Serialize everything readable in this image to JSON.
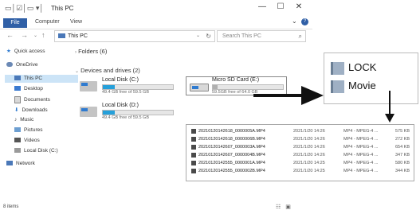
{
  "window": {
    "title": "This PC",
    "controls": {
      "minimize": "—",
      "maximize": "☐",
      "close": "✕"
    }
  },
  "ribbon": {
    "tabs": [
      "File",
      "Computer",
      "View"
    ],
    "expand": "⌄",
    "help": "?"
  },
  "navbar": {
    "back": "←",
    "forward": "→",
    "up": "↑",
    "address": "This PC",
    "refresh": "↻",
    "search_placeholder": "Search This PC",
    "search_icon": "search-icon"
  },
  "sidebar": {
    "items": [
      {
        "label": "Quick access",
        "icon": "star-icon"
      },
      {
        "label": "OneDrive",
        "icon": "cloud-icon"
      },
      {
        "label": "This PC",
        "icon": "computer-icon"
      },
      {
        "label": "Desktop",
        "icon": "desktop-icon"
      },
      {
        "label": "Documents",
        "icon": "documents-icon"
      },
      {
        "label": "Downloads",
        "icon": "downloads-icon"
      },
      {
        "label": "Music",
        "icon": "music-icon"
      },
      {
        "label": "Pictures",
        "icon": "pictures-icon"
      },
      {
        "label": "Videos",
        "icon": "videos-icon"
      },
      {
        "label": "Local Disk (C:)",
        "icon": "drive-icon"
      },
      {
        "label": "Network",
        "icon": "network-icon"
      }
    ]
  },
  "content": {
    "folders_header": "Folders (6)",
    "drives_header": "Devices and drives (2)",
    "drives": [
      {
        "name": "Local Disk (C:)",
        "free": "49.4 GB free of 59.5 GB",
        "used_fraction": 0.17
      },
      {
        "name": "Micro SD Card  (E:)",
        "free": "59.5GB free of 64.0 GB",
        "used_fraction": 0.07
      },
      {
        "name": "Local Disk (D:)",
        "free": "49.4 GB free of 59.5 GB",
        "used_fraction": 0.17
      }
    ]
  },
  "status": {
    "items": "8 items"
  },
  "sd_folders": [
    "LOCK",
    "Movie"
  ],
  "files": [
    {
      "name": "20210120142618_0000005A.MP4",
      "date": "2021/1/20 14:26",
      "type": "MP4 - MPEG-4 ...",
      "size": "575 KB"
    },
    {
      "name": "20210120142618_0000006B.MP4",
      "date": "2021/1/20 14:26",
      "type": "MP4 - MPEG-4 ...",
      "size": "272 KB"
    },
    {
      "name": "20210120142607_0000003A.MP4",
      "date": "2021/1/20 14:26",
      "type": "MP4 - MPEG-4 ...",
      "size": "654 KB"
    },
    {
      "name": "20210120142607_0000004B.MP4",
      "date": "2021/1/20 14:26",
      "type": "MP4 - MPEG-4 ...",
      "size": "347 KB"
    },
    {
      "name": "20210120142555_0000001A.MP4",
      "date": "2021/1/20 14:25",
      "type": "MP4 - MPEG-4 ...",
      "size": "580 KB"
    },
    {
      "name": "20210120142555_0000002B.MP4",
      "date": "2021/1/20 14:25",
      "type": "MP4 - MPEG-4 ...",
      "size": "344 KB"
    }
  ],
  "colors": {
    "accent": "#2f5fa6",
    "drive_bar": "#26a0da",
    "selection": "#cce4f7"
  }
}
